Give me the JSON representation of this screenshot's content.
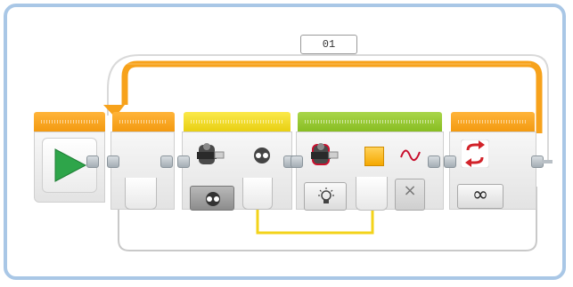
{
  "loop": {
    "name": "01",
    "mode_symbol": "∞"
  },
  "wait_block": {
    "symbol": "×"
  },
  "colors": {
    "start": "#f39a10",
    "loop": "#f7a21b",
    "yellow_block": "#f0d714",
    "green_block": "#8cc229",
    "frame": "#a9c7e6"
  },
  "icons": [
    "play-icon",
    "touch-sensor-icon",
    "touch-state-icon",
    "color-sensor-icon",
    "light-bulb-icon",
    "color-swatch-icon",
    "wave-icon",
    "loop-arrows-icon",
    "infinity-icon"
  ]
}
